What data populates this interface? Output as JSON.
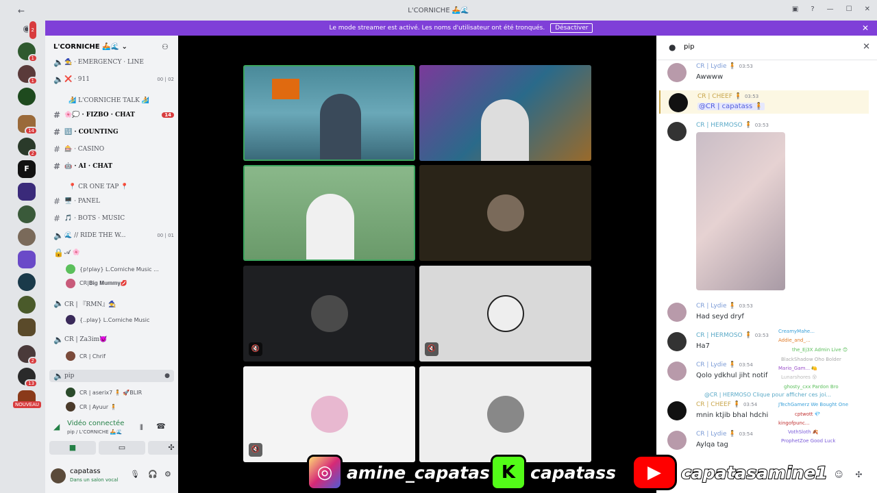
{
  "window": {
    "title": "L'CORNICHE 🚣🌊"
  },
  "banner": {
    "text": "Le mode streamer est activé. Les noms d'utilisateur ont été tronqués.",
    "button": "Désactiver"
  },
  "guild_badges": [
    "2",
    "1",
    "1",
    "",
    "14",
    "2",
    "",
    "",
    "",
    "",
    "",
    "",
    "",
    "",
    "",
    "2",
    "13"
  ],
  "guild_new": "NOUVEAU",
  "server": {
    "name": "L'CORNICHE 🚣🌊"
  },
  "channels": [
    {
      "type": "voice",
      "name": "🧙 · EMERGENCY · LINE",
      "bold": false
    },
    {
      "type": "voice",
      "name": "❌ · 911",
      "count_a": "00",
      "count_b": "02"
    },
    {
      "type": "category",
      "name": "🏄 L'CORNICHE TALK 🏄"
    },
    {
      "type": "text",
      "name": "🌸💭 · FIZBO · CHAT",
      "badge": "14",
      "bold": true
    },
    {
      "type": "text",
      "name": "🔢 · COUNTING",
      "bold": true
    },
    {
      "type": "text",
      "name": "🎰 · CASINO"
    },
    {
      "type": "text",
      "name": "🤖 · AI · CHAT",
      "bold": true
    },
    {
      "type": "category",
      "name": "📍 CR ONE TAP 📍"
    },
    {
      "type": "text",
      "name": "🖥️ · PANEL"
    },
    {
      "type": "text",
      "name": "🎵 · BOTS · MUSIC"
    },
    {
      "type": "voice",
      "name": "🌊 // RIDE THE W...",
      "count_a": "00",
      "count_b": "01"
    },
    {
      "type": "voice",
      "name": "𝓐 🌸"
    }
  ],
  "voice_users": [
    {
      "name": "{p!play} L.Corniche Music ..."
    },
    {
      "name": "CR|𝐁𝐢𝐠 𝐌𝐮𝐦𝐦𝐲💋"
    },
    {
      "name": "CR | 『RMN』🧙",
      "channel": true
    },
    {
      "name": "{..play} L.Corniche Music"
    },
    {
      "name": "CR | Za3im😈",
      "channel": true
    },
    {
      "name": "CR | Chrif"
    },
    {
      "name": "pip",
      "channel": true
    },
    {
      "name": "CR | aserix7 🧍 🚀BLIR"
    },
    {
      "name": "CR | Ayuur 🧍"
    }
  ],
  "voice_status": {
    "title": "Vidéo connectée",
    "sub": "pip / L'CORNICHE 🚣🌊"
  },
  "me": {
    "name": "capatass",
    "status": "Dans un salon vocal"
  },
  "thread": {
    "name": "pip"
  },
  "messages": [
    {
      "name": "CR | Lydie 🧍",
      "time": "03:53",
      "text": "Awwww",
      "color": "#7b9bd6"
    },
    {
      "name": "CR | CHEEF 🧍",
      "time": "03:53",
      "text": "@CR | capatass 🧍",
      "color": "#c8a54a",
      "mention": true
    },
    {
      "name": "CR | HERMOSO 🧍",
      "time": "03:53",
      "text": "",
      "color": "#5aa9c7"
    },
    {
      "name": "CR | Lydie 🧍",
      "time": "03:53",
      "text": "Had seyd dryf",
      "color": "#7b9bd6"
    },
    {
      "name": "CR | HERMOSO 🧍",
      "time": "03:53",
      "text": "Ha7",
      "color": "#5aa9c7"
    },
    {
      "name": "CR | Lydie 🧍",
      "time": "03:54",
      "text": "Qolo ydkhul jiht notif",
      "color": "#7b9bd6"
    },
    {
      "name": "CR | CHEEF 🧍",
      "time": "03:54",
      "text": "mnin ktjib bhal hdchi",
      "color": "#c8a54a",
      "reply": "@CR | HERMOSO Clique pour afficher ces joi..."
    },
    {
      "name": "CR | Lydie 🧍",
      "time": "03:54",
      "text": "Aylqa tag",
      "color": "#7b9bd6"
    }
  ],
  "overlay_names": [
    {
      "t": "CreamyMahe...",
      "c": "#3aa0d9"
    },
    {
      "t": "Addie_and_...",
      "c": "#e07b28"
    },
    {
      "t": "the_Ej3X  Admin Live 😊",
      "c": "#5bbf5b"
    },
    {
      "t": "BlackShadow  Oho Bolder",
      "c": "#aaaaaa"
    },
    {
      "t": "Mario_Gam... 🍋",
      "c": "#9b4fc9"
    },
    {
      "t": "Lunarshores 😵",
      "c": "#bbbbbb"
    },
    {
      "t": "ghosty_cxx  Pardon Bro",
      "c": "#5bbf5b"
    },
    {
      "t": "JTechGamerz  We Bought One",
      "c": "#3aa0d9"
    },
    {
      "t": "cptwott 💎",
      "c": "#c03030"
    },
    {
      "t": "kingofpunc...",
      "c": "#c03030"
    },
    {
      "t": "VothSloth 🍂",
      "c": "#7a5bd9"
    },
    {
      "t": "ProphetZoe  Good Luck",
      "c": "#7a5bd9"
    }
  ],
  "socials": [
    {
      "handle": "amine_capatas",
      "logo": "◎",
      "color": "#d6307a"
    },
    {
      "handle": "capatass",
      "logo": "K",
      "color": "#53fc18"
    },
    {
      "handle": "capatasamine1",
      "logo": "▶",
      "color": "#ff0000"
    }
  ],
  "colors": {
    "banner": "#7f3fd8",
    "speaking": "#3ba55d",
    "connected": "#248046"
  }
}
